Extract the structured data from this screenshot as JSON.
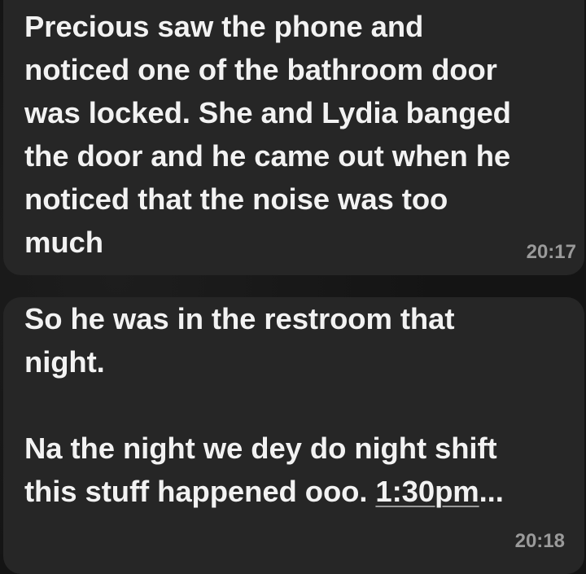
{
  "messages": [
    {
      "text": "Precious saw the phone and\nnoticed one of the bathroom door\nwas locked. She and Lydia banged\nthe door and he came out when he\nnoticed that the noise was too\nmuch",
      "time": "20:17"
    },
    {
      "text_before": "So he was in the restroom that\nnight.\n\nNa the night we dey do night shift\nthis stuff happened ooo. ",
      "link": "1:30pm",
      "text_after": "...",
      "time": "20:18"
    }
  ],
  "colors": {
    "background": "#141414",
    "bubble": "#262626",
    "text": "#f2f2f2",
    "timestamp": "#9a9a9a"
  }
}
